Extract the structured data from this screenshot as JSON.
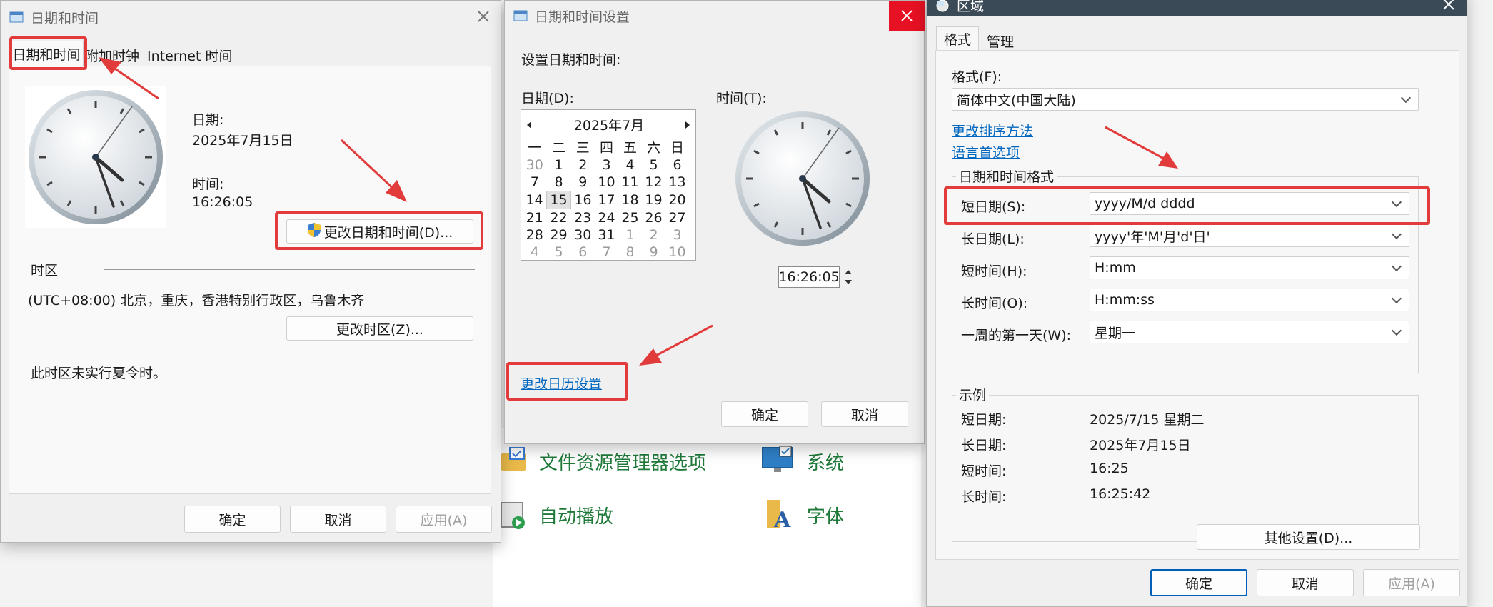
{
  "controlpanel": {
    "items": [
      {
        "label": "文件资源管理器选项",
        "icon": "folder-options-icon"
      },
      {
        "label": "系统",
        "icon": "system-monitor-icon"
      },
      {
        "label": "自动播放",
        "icon": "autoplay-icon"
      },
      {
        "label": "字体",
        "icon": "fonts-icon"
      }
    ]
  },
  "dialog1": {
    "title": "日期和时间",
    "tabs": [
      "日期和时间",
      "附加时钟",
      "Internet 时间"
    ],
    "date_label": "日期:",
    "date_value": "2025年7月15日",
    "time_label": "时间:",
    "time_value": "16:26:05",
    "change_datetime_button": "更改日期和时间(D)...",
    "timezone_label": "时区",
    "timezone_value": "(UTC+08:00) 北京，重庆，香港特别行政区，乌鲁木齐",
    "change_timezone_button": "更改时区(Z)...",
    "dst_note": "此时区未实行夏令时。",
    "ok_button": "确定",
    "cancel_button": "取消",
    "apply_button": "应用(A)"
  },
  "dialog2": {
    "title": "日期和时间设置",
    "heading": "设置日期和时间:",
    "date_label": "日期(D):",
    "time_label": "时间(T):",
    "calendar": {
      "month_title": "2025年7月",
      "weekdays": [
        "一",
        "二",
        "三",
        "四",
        "五",
        "六",
        "日"
      ],
      "weeks": [
        [
          "30",
          "1",
          "2",
          "3",
          "4",
          "5",
          "6"
        ],
        [
          "7",
          "8",
          "9",
          "10",
          "11",
          "12",
          "13"
        ],
        [
          "14",
          "15",
          "16",
          "17",
          "18",
          "19",
          "20"
        ],
        [
          "21",
          "22",
          "23",
          "24",
          "25",
          "26",
          "27"
        ],
        [
          "28",
          "29",
          "30",
          "31",
          "1",
          "2",
          "3"
        ],
        [
          "4",
          "5",
          "6",
          "7",
          "8",
          "9",
          "10"
        ]
      ],
      "selected_day": "15"
    },
    "time_input": "16:26:05",
    "change_calendar_link": "更改日历设置",
    "ok_button": "确定",
    "cancel_button": "取消"
  },
  "dialog3": {
    "title": "区域",
    "tabs": [
      "格式",
      "管理"
    ],
    "format_label": "格式(F):",
    "format_value": "简体中文(中国大陆)",
    "sort_link": "更改排序方法",
    "lang_link": "语言首选项",
    "datetime_group": "日期和时间格式",
    "fields": [
      {
        "label": "短日期(S):",
        "value": "yyyy/M/d dddd"
      },
      {
        "label": "长日期(L):",
        "value": "yyyy'年'M'月'd'日'"
      },
      {
        "label": "短时间(H):",
        "value": "H:mm"
      },
      {
        "label": "长时间(O):",
        "value": "H:mm:ss"
      },
      {
        "label": "一周的第一天(W):",
        "value": "星期一"
      }
    ],
    "example_group": "示例",
    "examples": [
      {
        "label": "短日期:",
        "value": "2025/7/15 星期二"
      },
      {
        "label": "长日期:",
        "value": "2025年7月15日"
      },
      {
        "label": "短时间:",
        "value": "16:25"
      },
      {
        "label": "长时间:",
        "value": "16:25:42"
      }
    ],
    "other_settings_button": "其他设置(D)...",
    "ok_button": "确定",
    "cancel_button": "取消",
    "apply_button": "应用(A)"
  },
  "colors": {
    "annotation_red": "#e23b3b",
    "link_blue": "#0067c0",
    "close_red": "#e81123"
  }
}
